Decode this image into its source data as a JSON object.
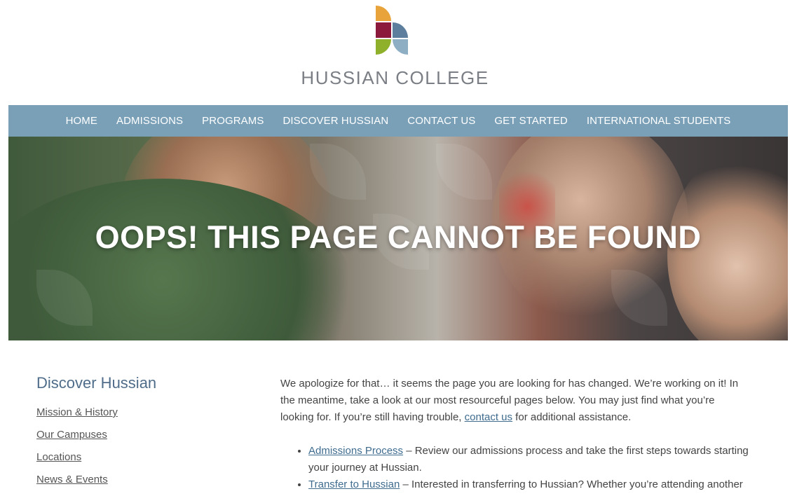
{
  "header": {
    "college_name": "HUSSIAN COLLEGE",
    "logo_colors": {
      "orange": "#e8a33a",
      "maroon": "#8b1a3c",
      "green": "#8fb02b",
      "blue": "#5d7f9d",
      "light_blue": "#8eaec4"
    }
  },
  "nav": {
    "items": [
      {
        "label": "HOME"
      },
      {
        "label": "ADMISSIONS"
      },
      {
        "label": "PROGRAMS"
      },
      {
        "label": "DISCOVER HUSSIAN"
      },
      {
        "label": "CONTACT US"
      },
      {
        "label": "GET STARTED"
      },
      {
        "label": "INTERNATIONAL STUDENTS"
      }
    ],
    "background_color": "#7aa0b8"
  },
  "hero": {
    "title": "OOPS! THIS PAGE CANNOT BE FOUND"
  },
  "sidebar": {
    "heading": "Discover Hussian",
    "links": [
      {
        "label": "Mission & History"
      },
      {
        "label": "Our Campuses"
      },
      {
        "label": "Locations"
      },
      {
        "label": "News & Events"
      }
    ]
  },
  "main": {
    "intro_text": "We apologize for that… it seems the page you are looking for has changed. We’re working on it! In the meantime, take a look at our most resourceful pages below. You may just find what you’re looking for. If you’re still having trouble, ",
    "contact_link": "contact us",
    "intro_suffix": " for additional assistance.",
    "list": [
      {
        "link": "Admissions Process",
        "text": " – Review our admissions process and take the first steps towards starting your journey at Hussian."
      },
      {
        "link": "Transfer to Hussian",
        "text": " – Interested in transferring to Hussian? Whether you’re attending another"
      }
    ]
  }
}
